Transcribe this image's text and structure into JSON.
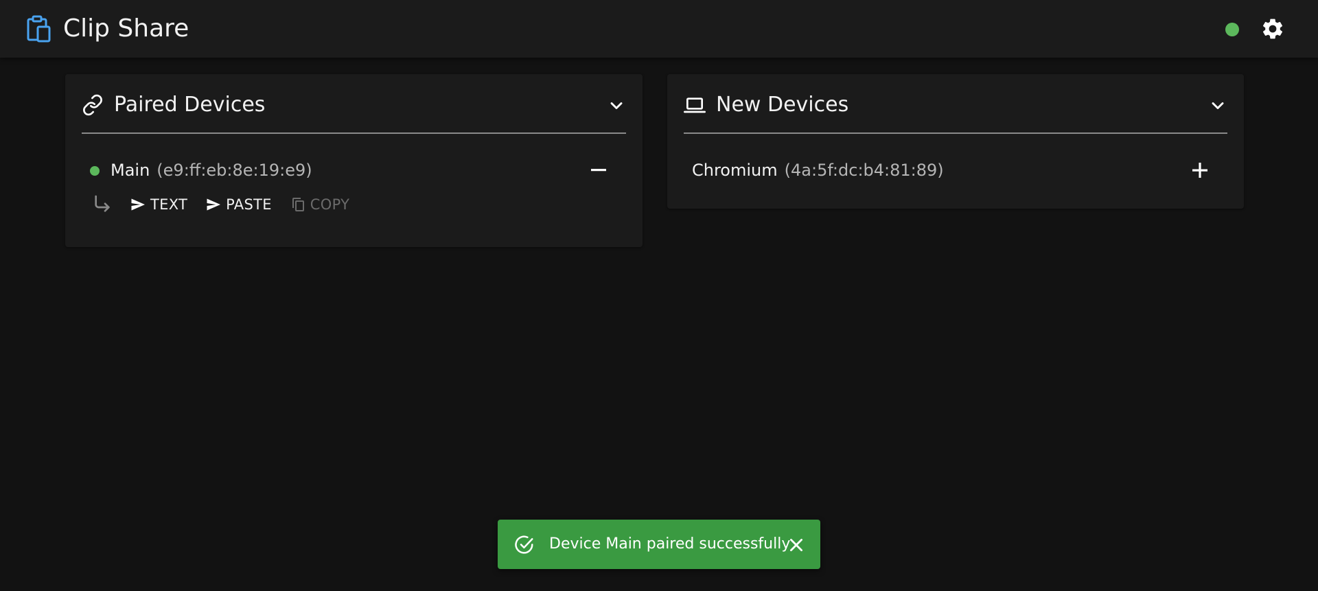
{
  "app": {
    "title": "Clip Share",
    "icon": "clipboard-share-icon",
    "accent_color": "#4aa3f0",
    "status_color": "#5cb85c"
  },
  "paired": {
    "title": "Paired Devices",
    "icon": "link-icon",
    "devices": [
      {
        "name": "Main",
        "mac": "(e9:ff:eb:8e:19:e9)",
        "online": true,
        "actions": [
          {
            "label": "TEXT",
            "icon": "send-icon",
            "enabled": true
          },
          {
            "label": "PASTE",
            "icon": "send-icon",
            "enabled": true
          },
          {
            "label": "COPY",
            "icon": "copy-icon",
            "enabled": false
          }
        ]
      }
    ]
  },
  "new_devices": {
    "title": "New Devices",
    "icon": "laptop-icon",
    "devices": [
      {
        "name": "Chromium",
        "mac": "(4a:5f:dc:b4:81:89)"
      }
    ]
  },
  "snackbar": {
    "message": "Device Main paired successfully",
    "color": "#3a9a41",
    "icon": "check-circle-icon"
  }
}
